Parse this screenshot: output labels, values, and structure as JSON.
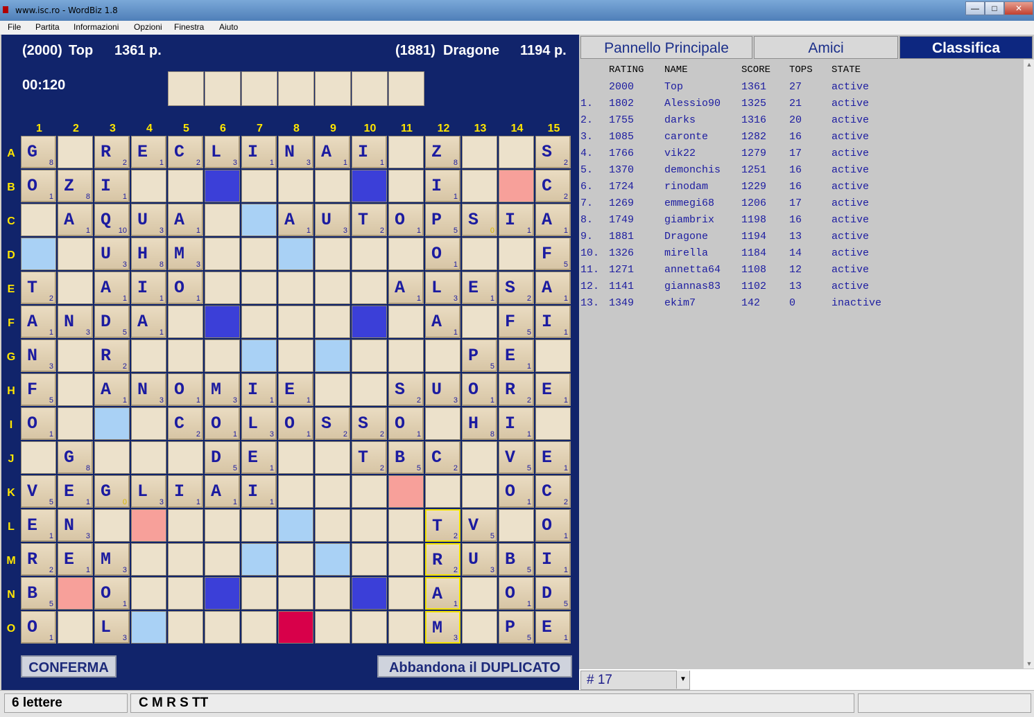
{
  "window": {
    "title": "www.isc.ro - WordBiz 1.8",
    "min": "—",
    "max": "□",
    "close": "✕"
  },
  "menu": [
    "File",
    "Partita",
    "Informazioni",
    "Opzioni",
    "Finestra",
    "Aiuto"
  ],
  "game": {
    "player1": {
      "rating": "(2000)",
      "name": "Top",
      "score": "1361 p."
    },
    "player2": {
      "rating": "(1881)",
      "name": "Dragone",
      "score": "1194 p."
    },
    "timer": "00:120",
    "rack_slots": 7,
    "col_labels": [
      "1",
      "2",
      "3",
      "4",
      "5",
      "6",
      "7",
      "8",
      "9",
      "10",
      "11",
      "12",
      "13",
      "14",
      "15"
    ],
    "row_labels": [
      "A",
      "B",
      "C",
      "D",
      "E",
      "F",
      "G",
      "H",
      "I",
      "J",
      "K",
      "L",
      "M",
      "N",
      "O"
    ],
    "board": [
      [
        "G8",
        "_",
        "R2",
        "E1",
        "C2",
        "L3",
        "I1",
        "N3",
        "A1",
        "I1",
        "_",
        "Z8",
        "_",
        "_",
        "S2"
      ],
      [
        "O1",
        "Z8",
        "I1",
        "_",
        "_",
        "#",
        "_",
        "_",
        "_",
        "#",
        "_",
        "I1",
        "_",
        "p",
        "C2"
      ],
      [
        "_",
        "A1",
        "Q10",
        "U3",
        "A1",
        "_",
        "b",
        "A1",
        "U3",
        "T2",
        "O1",
        "P5",
        "S0",
        "I1",
        "A1"
      ],
      [
        "b",
        "_",
        "U3",
        "H8",
        "M3",
        "_",
        "_",
        "b",
        "_",
        "_",
        "_",
        "O1",
        "_",
        "_",
        "F5"
      ],
      [
        "T2",
        "_",
        "A1",
        "I1",
        "O1",
        "_",
        "_",
        "_",
        "_",
        "_",
        "A1",
        "L3",
        "E1",
        "S2",
        "A1"
      ],
      [
        "A1",
        "N3",
        "D5",
        "A1",
        "_",
        "#",
        "_",
        "_",
        "_",
        "#",
        "_",
        "A1",
        "_",
        "F5",
        "I1"
      ],
      [
        "N3",
        "_",
        "R2",
        "_",
        "_",
        "_",
        "b",
        "_",
        "b",
        "_",
        "_",
        "_",
        "P5",
        "E1",
        "_"
      ],
      [
        "F5",
        "_",
        "A1",
        "N3",
        "O1",
        "M3",
        "I1",
        "E1",
        "_",
        "_",
        "S2",
        "U3",
        "O1",
        "R2",
        "E1"
      ],
      [
        "O1",
        "_",
        "b",
        "_",
        "C2",
        "O1",
        "L3",
        "O1",
        "S2",
        "S2",
        "O1",
        "_",
        "H8",
        "I1",
        "_"
      ],
      [
        "_",
        "G8",
        "_",
        "_",
        "_",
        "D5",
        "E1",
        "_",
        "_",
        "T2",
        "B5",
        "C2",
        "_",
        "V5",
        "E1"
      ],
      [
        "V5",
        "E1",
        "G0",
        "L3",
        "I1",
        "A1",
        "I1",
        "_",
        "_",
        "_",
        "p",
        "_",
        "_",
        "O1",
        "C2"
      ],
      [
        "E1",
        "N3",
        "_",
        "p",
        "_",
        "_",
        "_",
        "b",
        "_",
        "_",
        "_",
        "T2!",
        "V5",
        "_",
        "O1"
      ],
      [
        "R2",
        "E1",
        "M3",
        "_",
        "_",
        "_",
        "b",
        "_",
        "b",
        "_",
        "_",
        "R2!",
        "U3",
        "B5",
        "I1"
      ],
      [
        "B5",
        "p",
        "O1",
        "_",
        "_",
        "#",
        "_",
        "_",
        "_",
        "#",
        "_",
        "A1!",
        "_",
        "O1",
        "D5"
      ],
      [
        "O1",
        "_",
        "L3",
        "b",
        "_",
        "_",
        "_",
        "r",
        "_",
        "_",
        "_",
        "M3!",
        "_",
        "P5",
        "E1"
      ]
    ],
    "confirm_label": "CONFERMA",
    "abandon_label": "Abbandona il DUPLICATO"
  },
  "tabs": [
    "Pannello Principale",
    "Amici",
    "Classifica"
  ],
  "active_tab": "Classifica",
  "ranking": {
    "headers": [
      "RATING",
      "NAME",
      "SCORE",
      "TOPS",
      "STATE"
    ],
    "rows": [
      [
        "",
        "2000",
        "Top",
        "1361",
        "27",
        "active"
      ],
      [
        "1.",
        "1802",
        "Alessio90",
        "1325",
        "21",
        "active"
      ],
      [
        "2.",
        "1755",
        "darks",
        "1316",
        "20",
        "active"
      ],
      [
        "3.",
        "1085",
        "caronte",
        "1282",
        "16",
        "active"
      ],
      [
        "4.",
        "1766",
        "vik22",
        "1279",
        "17",
        "active"
      ],
      [
        "5.",
        "1370",
        "demonchis",
        "1251",
        "16",
        "active"
      ],
      [
        "6.",
        "1724",
        "rinodam",
        "1229",
        "16",
        "active"
      ],
      [
        "7.",
        "1269",
        "emmegi68",
        "1206",
        "17",
        "active"
      ],
      [
        "8.",
        "1749",
        "giambrix",
        "1198",
        "16",
        "active"
      ],
      [
        "9.",
        "1881",
        "Dragone",
        "1194",
        "13",
        "active"
      ],
      [
        "10.",
        "1326",
        "mirella",
        "1184",
        "14",
        "active"
      ],
      [
        "11.",
        "1271",
        "annetta64",
        "1108",
        "12",
        "active"
      ],
      [
        "12.",
        "1141",
        "giannas83",
        "1102",
        "13",
        "active"
      ],
      [
        "13.",
        "1349",
        "ekim7",
        "142",
        "0",
        "inactive"
      ]
    ]
  },
  "turn": "# 17",
  "status": {
    "letters": "6 lettere",
    "rack": "C M R S TT",
    "extra": ""
  },
  "colors": {
    "panel": "#11246b",
    "label": "#ffe600",
    "tile_text": "#1b1ba0",
    "dbl_word": "#3b3fd8",
    "dbl_letter": "#a9d1f5",
    "tri": "#f7a09a",
    "center": "#d8004a"
  }
}
